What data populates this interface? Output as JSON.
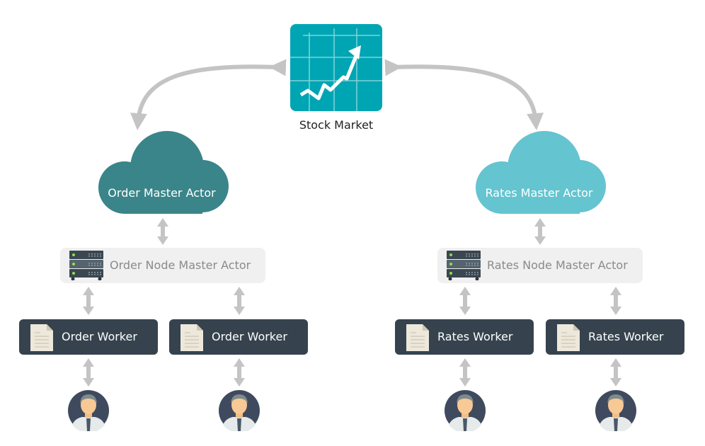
{
  "stock_market": {
    "label": "Stock Market",
    "color": "#00a5b3"
  },
  "order": {
    "master": {
      "label": "Order Master Actor",
      "color": "#3a8589"
    },
    "node": {
      "label": "Order Node Master Actor"
    },
    "workers": [
      {
        "label": "Order Worker"
      },
      {
        "label": "Order Worker"
      }
    ]
  },
  "rates": {
    "master": {
      "label": "Rates Master Actor",
      "color": "#64c4d0"
    },
    "node": {
      "label": "Rates Node Master Actor"
    },
    "workers": [
      {
        "label": "Rates Worker"
      },
      {
        "label": "Rates Worker"
      }
    ]
  },
  "colors": {
    "arrow": "#c4c4c4",
    "worker_bg": "#36434e",
    "node_bg": "#f0f0f0"
  }
}
